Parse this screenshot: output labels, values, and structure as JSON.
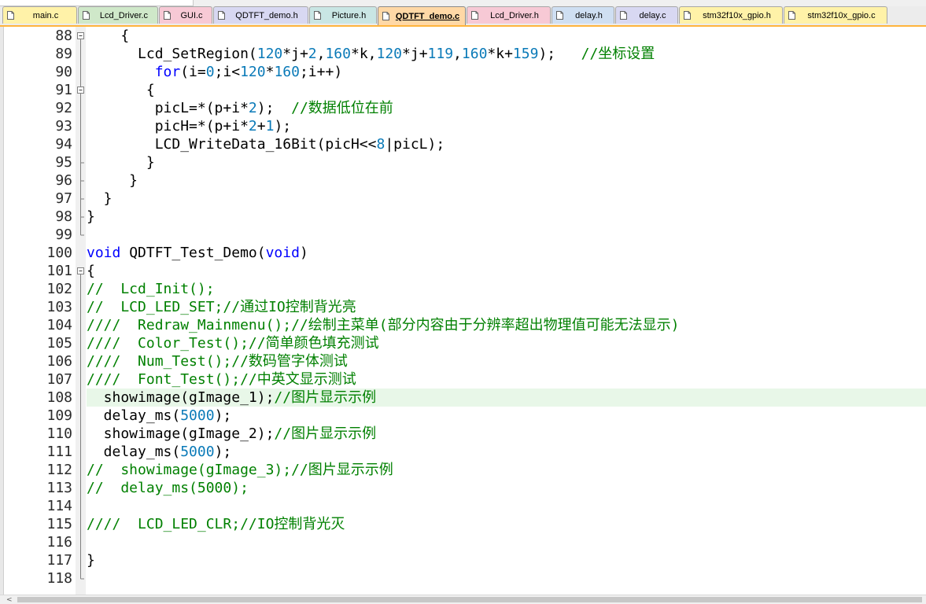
{
  "colors": {
    "tab_yellow": "#fff2a8",
    "tab_green": "#cfe8c9",
    "tab_pink": "#f7c9d5",
    "tab_lavender": "#d8d8f2",
    "tab_teal": "#c9e6e4",
    "tab_orange": "#ffd8a6",
    "tab_blue": "#cfdff2",
    "accent": "#ffb43c",
    "keyword": "#0000ff",
    "number": "#0a7ab8",
    "comment": "#008000",
    "highlight": "#e8f7e8"
  },
  "tabs": [
    {
      "label": "main.c",
      "color": "#fff2a8",
      "active": false
    },
    {
      "label": "Lcd_Driver.c",
      "color": "#cfe8c9",
      "active": false
    },
    {
      "label": "GUI.c",
      "color": "#f7c9d5",
      "active": false
    },
    {
      "label": "QDTFT_demo.h",
      "color": "#d8d8f2",
      "active": false
    },
    {
      "label": "Picture.h",
      "color": "#c9e6e4",
      "active": false
    },
    {
      "label": "QDTFT_demo.c",
      "color": "#ffd8a6",
      "active": true
    },
    {
      "label": "Lcd_Driver.h",
      "color": "#f7c9d5",
      "active": false
    },
    {
      "label": "delay.h",
      "color": "#cfdff2",
      "active": false
    },
    {
      "label": "delay.c",
      "color": "#d8d8f2",
      "active": false
    },
    {
      "label": "stm32f10x_gpio.h",
      "color": "#fff2a8",
      "active": false
    },
    {
      "label": "stm32f10x_gpio.c",
      "color": "#fff2a8",
      "active": false
    }
  ],
  "lines": [
    {
      "n": "88",
      "fold": "open",
      "code": [
        {
          "t": "    {"
        }
      ]
    },
    {
      "n": "89",
      "fold": "line",
      "code": [
        {
          "t": "      Lcd_SetRegion("
        },
        {
          "t": "120",
          "c": "num"
        },
        {
          "t": "*j+"
        },
        {
          "t": "2",
          "c": "num"
        },
        {
          "t": ","
        },
        {
          "t": "160",
          "c": "num"
        },
        {
          "t": "*k,"
        },
        {
          "t": "120",
          "c": "num"
        },
        {
          "t": "*j+"
        },
        {
          "t": "119",
          "c": "num"
        },
        {
          "t": ","
        },
        {
          "t": "160",
          "c": "num"
        },
        {
          "t": "*k+"
        },
        {
          "t": "159",
          "c": "num"
        },
        {
          "t": ");   "
        },
        {
          "t": "//坐标设置",
          "c": "cm"
        }
      ]
    },
    {
      "n": "90",
      "fold": "line",
      "code": [
        {
          "t": "        "
        },
        {
          "t": "for",
          "c": "kw"
        },
        {
          "t": "(i="
        },
        {
          "t": "0",
          "c": "num"
        },
        {
          "t": ";i<"
        },
        {
          "t": "120",
          "c": "num"
        },
        {
          "t": "*"
        },
        {
          "t": "160",
          "c": "num"
        },
        {
          "t": ";i++)"
        }
      ]
    },
    {
      "n": "91",
      "fold": "open",
      "code": [
        {
          "t": "       {"
        }
      ]
    },
    {
      "n": "92",
      "fold": "line",
      "code": [
        {
          "t": "        picL=*(p+i*"
        },
        {
          "t": "2",
          "c": "num"
        },
        {
          "t": ");  "
        },
        {
          "t": "//数据低位在前",
          "c": "cm"
        }
      ]
    },
    {
      "n": "93",
      "fold": "line",
      "code": [
        {
          "t": "        picH=*(p+i*"
        },
        {
          "t": "2",
          "c": "num"
        },
        {
          "t": "+"
        },
        {
          "t": "1",
          "c": "num"
        },
        {
          "t": ");"
        }
      ]
    },
    {
      "n": "94",
      "fold": "line",
      "code": [
        {
          "t": "        LCD_WriteData_16Bit(picH<<"
        },
        {
          "t": "8",
          "c": "num"
        },
        {
          "t": "|picL);"
        }
      ]
    },
    {
      "n": "95",
      "fold": "end",
      "code": [
        {
          "t": "       }"
        }
      ]
    },
    {
      "n": "96",
      "fold": "end",
      "code": [
        {
          "t": "     }"
        }
      ]
    },
    {
      "n": "97",
      "fold": "end",
      "code": [
        {
          "t": "  }"
        }
      ]
    },
    {
      "n": "98",
      "fold": "end",
      "code": [
        {
          "t": "}"
        }
      ]
    },
    {
      "n": "99",
      "fold": "close",
      "code": [
        {
          "t": ""
        }
      ]
    },
    {
      "n": "100",
      "fold": "none",
      "code": [
        {
          "t": "void",
          "c": "kw"
        },
        {
          "t": " QDTFT_Test_Demo("
        },
        {
          "t": "void",
          "c": "kw"
        },
        {
          "t": ")"
        }
      ]
    },
    {
      "n": "101",
      "fold": "open",
      "code": [
        {
          "t": "{"
        }
      ]
    },
    {
      "n": "102",
      "fold": "line",
      "code": [
        {
          "t": "//  Lcd_Init();",
          "c": "cm"
        }
      ]
    },
    {
      "n": "103",
      "fold": "line",
      "code": [
        {
          "t": "//  LCD_LED_SET;//通过IO控制背光亮",
          "c": "cm"
        }
      ]
    },
    {
      "n": "104",
      "fold": "line",
      "code": [
        {
          "t": "////  Redraw_Mainmenu();//绘制主菜单(部分内容由于分辨率超出物理值可能无法显示)",
          "c": "cm"
        }
      ]
    },
    {
      "n": "105",
      "fold": "line",
      "code": [
        {
          "t": "////  Color_Test();//简单颜色填充测试",
          "c": "cm"
        }
      ]
    },
    {
      "n": "106",
      "fold": "line",
      "code": [
        {
          "t": "////  Num_Test();//数码管字体测试",
          "c": "cm"
        }
      ]
    },
    {
      "n": "107",
      "fold": "line",
      "code": [
        {
          "t": "////  Font_Test();//中英文显示测试",
          "c": "cm"
        }
      ]
    },
    {
      "n": "108",
      "fold": "line",
      "hl": true,
      "code": [
        {
          "t": "  showimage(gImage_1);"
        },
        {
          "t": "//图片显示示例",
          "c": "cm"
        }
      ]
    },
    {
      "n": "109",
      "fold": "line",
      "code": [
        {
          "t": "  delay_ms("
        },
        {
          "t": "5000",
          "c": "num"
        },
        {
          "t": ");"
        }
      ]
    },
    {
      "n": "110",
      "fold": "line",
      "code": [
        {
          "t": "  showimage(gImage_2);"
        },
        {
          "t": "//图片显示示例",
          "c": "cm"
        }
      ]
    },
    {
      "n": "111",
      "fold": "line",
      "code": [
        {
          "t": "  delay_ms("
        },
        {
          "t": "5000",
          "c": "num"
        },
        {
          "t": ");"
        }
      ]
    },
    {
      "n": "112",
      "fold": "line",
      "code": [
        {
          "t": "//  showimage(gImage_3);//图片显示示例",
          "c": "cm"
        }
      ]
    },
    {
      "n": "113",
      "fold": "line",
      "code": [
        {
          "t": "//  delay_ms(5000);",
          "c": "cm"
        }
      ]
    },
    {
      "n": "114",
      "fold": "line",
      "code": [
        {
          "t": ""
        }
      ]
    },
    {
      "n": "115",
      "fold": "line",
      "code": [
        {
          "t": "////  LCD_LED_CLR;//IO控制背光灭",
          "c": "cm"
        }
      ]
    },
    {
      "n": "116",
      "fold": "line",
      "code": [
        {
          "t": ""
        }
      ]
    },
    {
      "n": "117",
      "fold": "line",
      "code": [
        {
          "t": "}"
        }
      ]
    },
    {
      "n": "118",
      "fold": "close",
      "code": [
        {
          "t": ""
        }
      ]
    }
  ]
}
